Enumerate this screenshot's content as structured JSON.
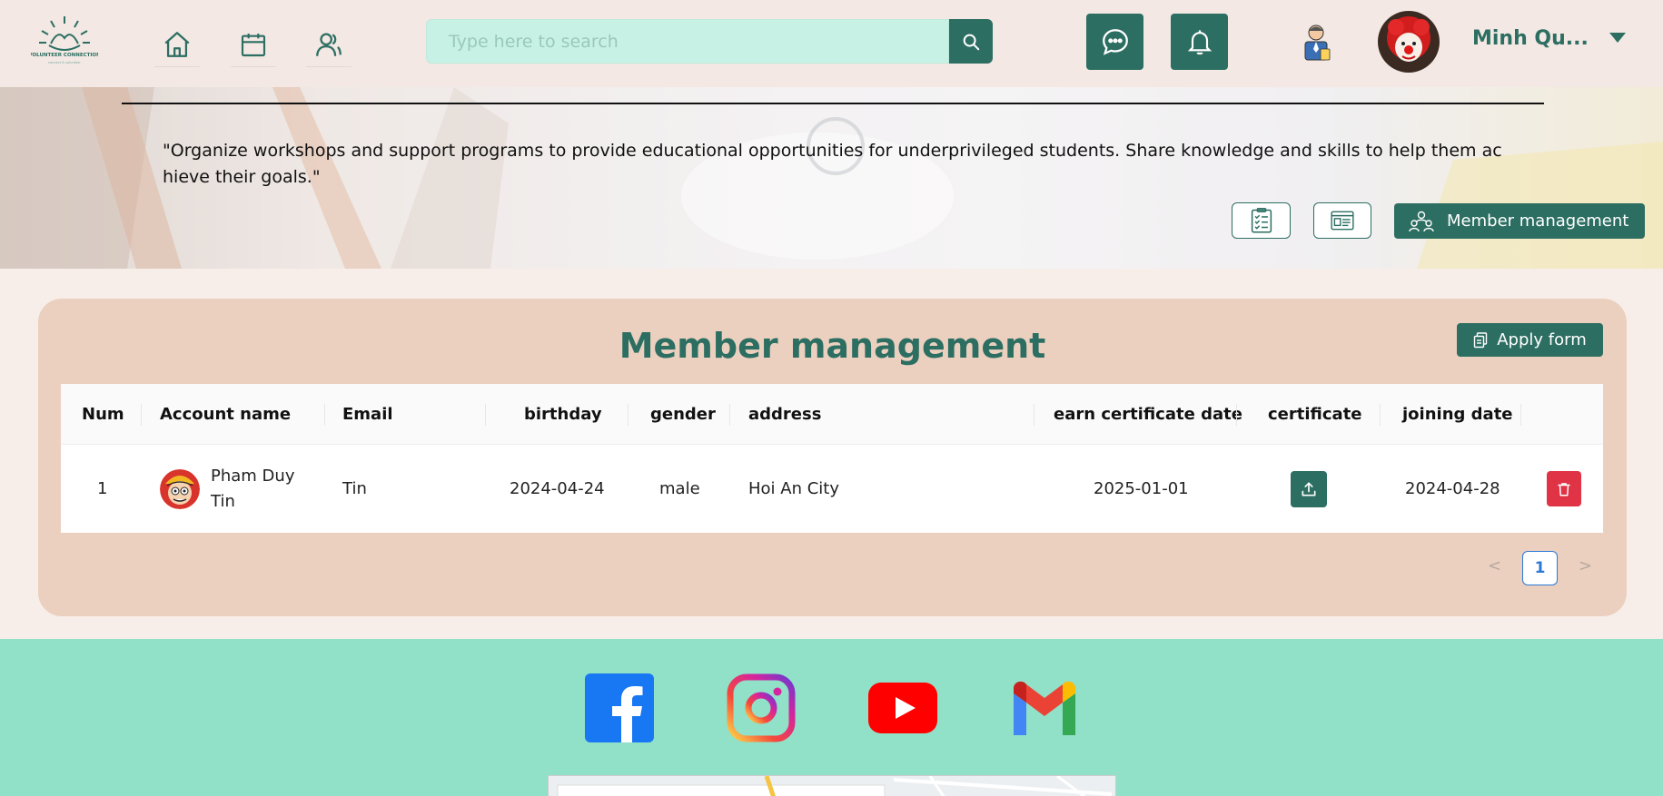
{
  "header": {
    "logo_text": "VOLUNTEER CONNECTION",
    "search": {
      "placeholder": "Type here to search"
    },
    "user": {
      "name": "Minh Qu..."
    }
  },
  "banner": {
    "quote": "\"Organize workshops and support programs to provide educational opportunities for underprivileged students. Share knowledge and skills to help them achieve their goals.\"",
    "member_button_label": "Member management"
  },
  "card": {
    "title": "Member management",
    "apply_button_label": "Apply form",
    "columns": [
      "Num",
      "Account name",
      "Email",
      "birthday",
      "gender",
      "address",
      "earn certificate date",
      "certificate",
      "joining date"
    ],
    "rows": [
      {
        "num": "1",
        "account_name": "Pham Duy Tin",
        "email": "Tin",
        "birthday": "2024-04-24",
        "gender": "male",
        "address": "Hoi An City",
        "earn_certificate_date": "2025-01-01",
        "joining_date": "2024-04-28"
      }
    ],
    "pagination": {
      "prev": "<",
      "current": "1",
      "next": ">"
    }
  },
  "colors": {
    "primary": "#2c6e62",
    "danger": "#e03346",
    "footer": "#91e0c8",
    "card": "#ecd0bf"
  },
  "footer": {
    "social": [
      "facebook-icon",
      "instagram-icon",
      "youtube-icon",
      "gmail-icon"
    ]
  }
}
